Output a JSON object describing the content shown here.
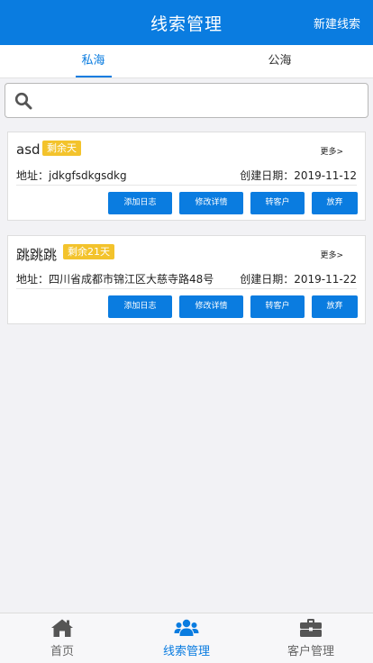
{
  "header": {
    "title": "线索管理",
    "new_button": "新建线索"
  },
  "tabs": [
    {
      "label": "私海",
      "active": true
    },
    {
      "label": "公海",
      "active": false
    }
  ],
  "search": {
    "placeholder": "",
    "value": ""
  },
  "leads": [
    {
      "name": "asd",
      "badge": "剩余天",
      "more": "更多>",
      "address": "地址：jdkgfsdkgsdkg",
      "created": "创建日期：2019-11-12",
      "actions": [
        "添加日志",
        "修改详情",
        "转客户",
        "放弃"
      ]
    },
    {
      "name": "跳跳跳",
      "badge": "剩余21天",
      "more": "更多>",
      "address": "地址：四川省成都市锦江区大慈寺路48号",
      "created": "创建日期：2019-11-22",
      "actions": [
        "添加日志",
        "修改详情",
        "转客户",
        "放弃"
      ]
    }
  ],
  "tabbar": [
    {
      "label": "首页",
      "icon": "home-icon",
      "active": false
    },
    {
      "label": "线索管理",
      "icon": "users-icon",
      "active": true
    },
    {
      "label": "客户管理",
      "icon": "briefcase-icon",
      "active": false
    }
  ],
  "colors": {
    "primary": "#0a7ce0",
    "badge": "#f3c32c",
    "background": "#f2f2f5"
  }
}
